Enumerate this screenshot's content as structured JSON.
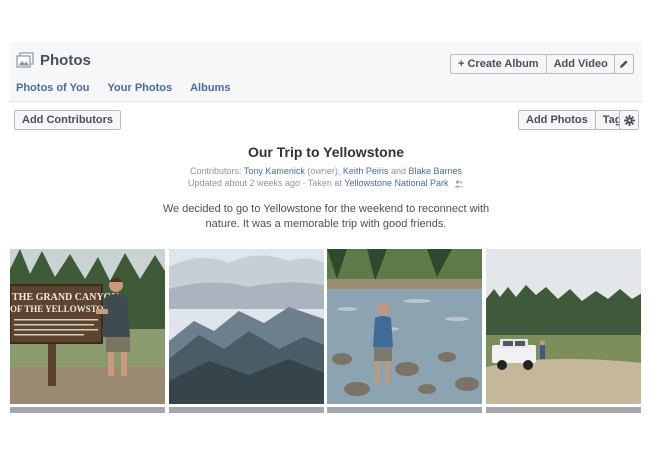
{
  "header": {
    "title": "Photos",
    "icon": "photos-icon",
    "nav": [
      "Photos of You",
      "Your Photos",
      "Albums"
    ],
    "create_album_label": "+ Create Album",
    "add_video_label": "Add Video",
    "edit_icon": "pencil-icon"
  },
  "toolbar": {
    "add_contributors_label": "Add Contributors",
    "add_photos_label": "Add Photos",
    "tag_label": "Tag",
    "settings_icon": "gear-icon"
  },
  "album": {
    "title": "Our Trip to Yellowstone",
    "contributors_prefix": "Contributors:",
    "contributor1": "Tony Kamenick",
    "owner_note": "(owner),",
    "contributor2": "Keith Peiris",
    "and_word": "and",
    "contributor3": "Blake Barnes",
    "updated_text": "Updated about 2 weeks ago · Taken at",
    "location": "Yellowstone National Park",
    "description": "We decided to go to Yellowstone for the weekend to reconnect with nature. It was a memorable trip with good friends."
  },
  "photos": {
    "sign_line1": "THE GRAND CANYON",
    "sign_line2": "OF THE YELLOWSTONE"
  },
  "colors": {
    "link": "#4a6aa5",
    "header_bg": "#f6f7f9"
  }
}
